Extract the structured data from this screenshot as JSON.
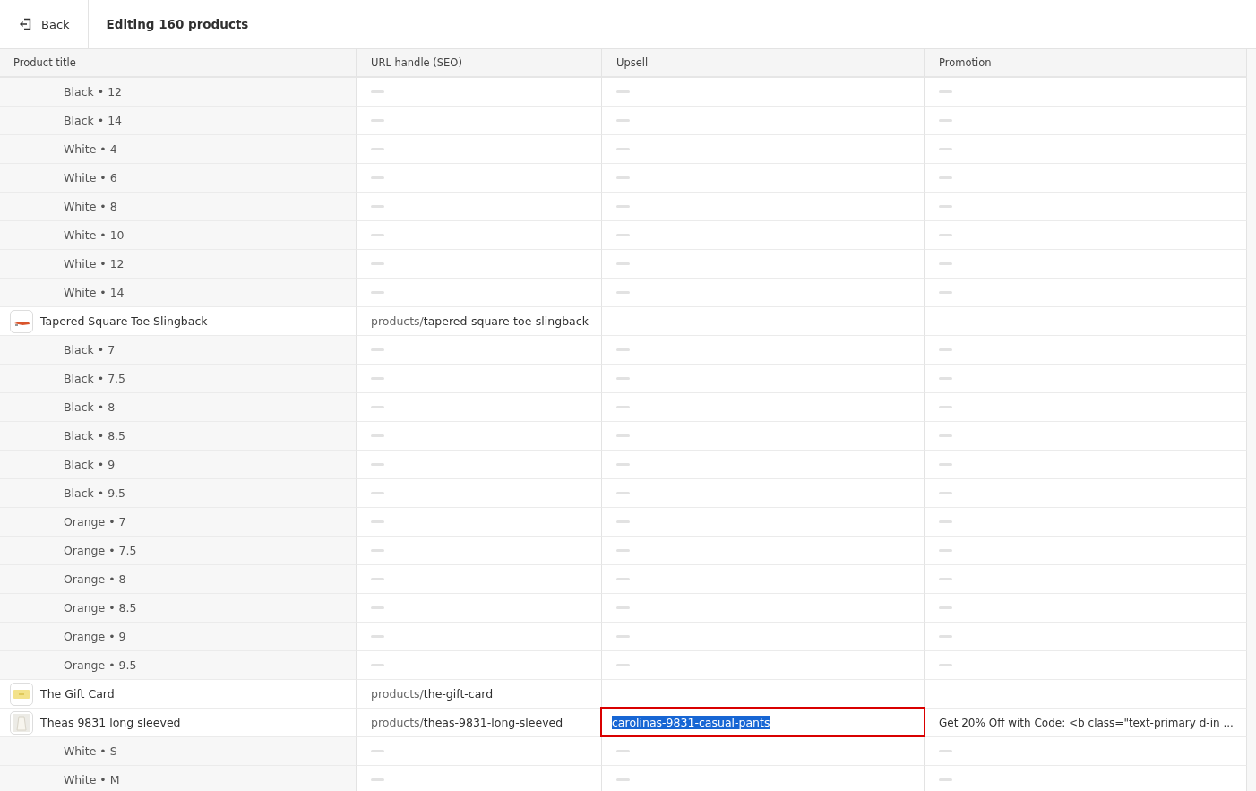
{
  "header": {
    "back_label": "Back",
    "title": "Editing 160 products"
  },
  "table": {
    "columns": [
      "Product title",
      "URL handle (SEO)",
      "Upsell",
      "Promotion"
    ],
    "rows": [
      {
        "kind": "variant",
        "title": "Black • 12"
      },
      {
        "kind": "variant",
        "title": "Black • 14"
      },
      {
        "kind": "variant",
        "title": "White • 4"
      },
      {
        "kind": "variant",
        "title": "White • 6"
      },
      {
        "kind": "variant",
        "title": "White • 8"
      },
      {
        "kind": "variant",
        "title": "White • 10"
      },
      {
        "kind": "variant",
        "title": "White • 12"
      },
      {
        "kind": "variant",
        "title": "White • 14"
      },
      {
        "kind": "product",
        "thumbnail": {
          "kind": "shoe"
        },
        "title": "Tapered Square Toe Slingback",
        "url_prefix": "products/",
        "url_slug": "tapered-square-toe-slingback"
      },
      {
        "kind": "variant",
        "title": "Black • 7"
      },
      {
        "kind": "variant",
        "title": "Black • 7.5"
      },
      {
        "kind": "variant",
        "title": "Black • 8"
      },
      {
        "kind": "variant",
        "title": "Black • 8.5"
      },
      {
        "kind": "variant",
        "title": "Black • 9"
      },
      {
        "kind": "variant",
        "title": "Black • 9.5"
      },
      {
        "kind": "variant",
        "title": "Orange • 7"
      },
      {
        "kind": "variant",
        "title": "Orange • 7.5"
      },
      {
        "kind": "variant",
        "title": "Orange • 8"
      },
      {
        "kind": "variant",
        "title": "Orange • 8.5"
      },
      {
        "kind": "variant",
        "title": "Orange • 9"
      },
      {
        "kind": "variant",
        "title": "Orange • 9.5"
      },
      {
        "kind": "product",
        "thumbnail": {
          "kind": "card"
        },
        "title": "The Gift Card",
        "url_prefix": "products/",
        "url_slug": "the-gift-card"
      },
      {
        "kind": "product",
        "thumbnail": {
          "kind": "photo"
        },
        "title": "Theas 9831 long sleeved",
        "url_prefix": "products/",
        "url_slug": "theas-9831-long-sleeved",
        "upsell": "carolinas-9831-casual-pants",
        "upsell_editing": true,
        "promotion": "Get 20% Off with Code: <b class=\"text-primary d-in ..."
      },
      {
        "kind": "variant",
        "title": "White • S"
      },
      {
        "kind": "variant",
        "title": "White • M"
      }
    ]
  }
}
